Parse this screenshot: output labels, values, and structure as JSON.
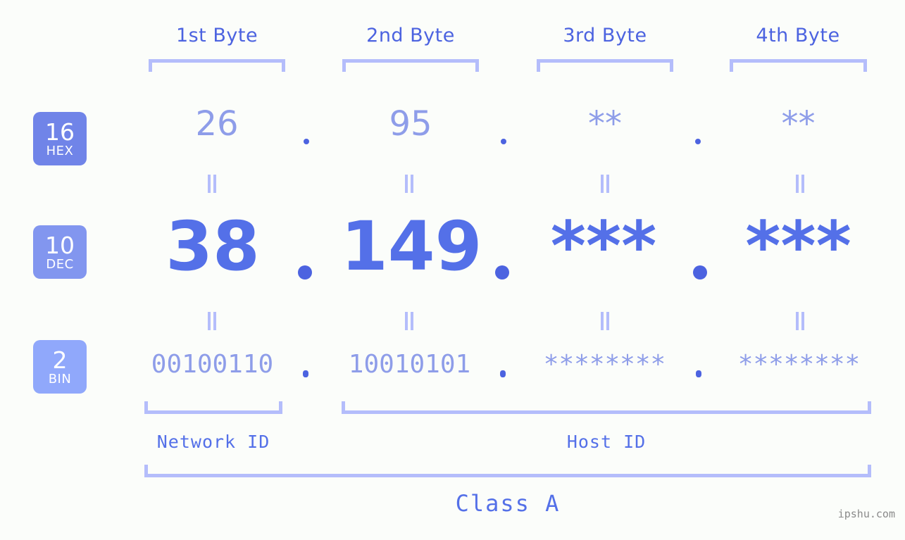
{
  "background_color": "#fbfdfa",
  "accent_colors": {
    "strong_blue": "#5470e8",
    "header_blue": "#4c63e0",
    "light_periwinkle": "#8e9de9",
    "bracket": "#b4bdfb",
    "hex_badge": "#7084e8",
    "dec_badge": "#8296ef",
    "bin_badge": "#90a8fb",
    "watermark": "#8a8a8a"
  },
  "headers": {
    "bytes": [
      {
        "label": "1st Byte"
      },
      {
        "label": "2nd Byte"
      },
      {
        "label": "3rd Byte"
      },
      {
        "label": "4th Byte"
      }
    ]
  },
  "bases": [
    {
      "number": "16",
      "name": "HEX"
    },
    {
      "number": "10",
      "name": "DEC"
    },
    {
      "number": "2",
      "name": "BIN"
    }
  ],
  "rows": {
    "hex": {
      "base_number": "16",
      "base_name": "HEX",
      "values": [
        "26",
        "95",
        "**",
        "**"
      ],
      "separator": "."
    },
    "dec": {
      "base_number": "10",
      "base_name": "DEC",
      "values": [
        "38",
        "149",
        "***",
        "***"
      ],
      "separator": "."
    },
    "bin": {
      "base_number": "2",
      "base_name": "BIN",
      "values": [
        "00100110",
        "10010101",
        "********",
        "********"
      ],
      "separator": "."
    }
  },
  "equivalence_marks": {
    "glyph": "||",
    "count_per_row": 4,
    "rows": 2
  },
  "footer": {
    "network_id_label": "Network ID",
    "host_id_label": "Host ID",
    "class_label": "Class A"
  },
  "watermark": {
    "text": "ipshu.com"
  }
}
